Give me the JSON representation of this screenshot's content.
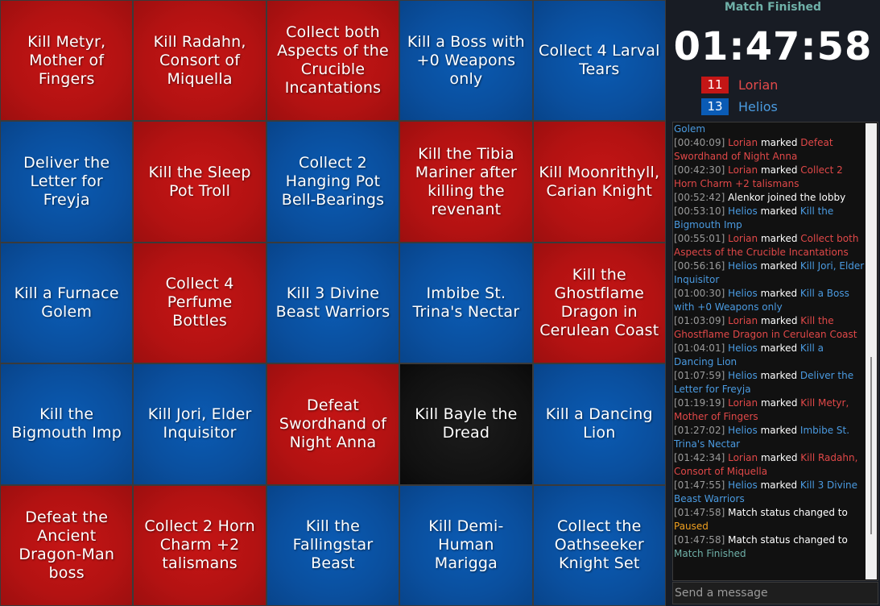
{
  "board": {
    "cells": [
      {
        "label": "Kill Metyr, Mother of Fingers",
        "color": "red"
      },
      {
        "label": "Kill Radahn, Consort of Miquella",
        "color": "red"
      },
      {
        "label": "Collect both Aspects of the Crucible Incantations",
        "color": "red"
      },
      {
        "label": "Kill a Boss with +0 Weapons only",
        "color": "blue"
      },
      {
        "label": "Collect 4 Larval Tears",
        "color": "blue"
      },
      {
        "label": "Deliver the Letter for Freyja",
        "color": "blue"
      },
      {
        "label": "Kill the Sleep Pot Troll",
        "color": "red"
      },
      {
        "label": "Collect 2 Hanging Pot Bell-Bearings",
        "color": "blue"
      },
      {
        "label": "Kill the Tibia Mariner after killing the revenant",
        "color": "red"
      },
      {
        "label": "Kill Moonrithyll, Carian Knight",
        "color": "red"
      },
      {
        "label": "Kill a Furnace Golem",
        "color": "blue"
      },
      {
        "label": "Collect 4 Perfume Bottles",
        "color": "red"
      },
      {
        "label": "Kill 3 Divine Beast Warriors",
        "color": "blue"
      },
      {
        "label": "Imbibe St. Trina's Nectar",
        "color": "blue"
      },
      {
        "label": "Kill the Ghostflame Dragon in Cerulean Coast",
        "color": "red"
      },
      {
        "label": "Kill the Bigmouth Imp",
        "color": "blue"
      },
      {
        "label": "Kill Jori, Elder Inquisitor",
        "color": "blue"
      },
      {
        "label": "Defeat Swordhand of Night Anna",
        "color": "red"
      },
      {
        "label": "Kill Bayle the Dread",
        "color": "black"
      },
      {
        "label": "Kill a Dancing Lion",
        "color": "blue"
      },
      {
        "label": "Defeat the Ancient Dragon-Man boss",
        "color": "red"
      },
      {
        "label": "Collect 2 Horn Charm +2 talismans",
        "color": "red"
      },
      {
        "label": "Kill the Fallingstar Beast",
        "color": "blue"
      },
      {
        "label": "Kill Demi-Human Marigga",
        "color": "blue"
      },
      {
        "label": "Collect the Oathseeker Knight Set",
        "color": "blue"
      }
    ]
  },
  "status": "Match Finished",
  "timer": "01:47:58",
  "teams": [
    {
      "count": "11",
      "name": "Lorian",
      "color": "#c41616"
    },
    {
      "count": "13",
      "name": "Helios",
      "color": "#0a5bb5"
    }
  ],
  "log": [
    {
      "segs": [
        {
          "t": "Golem",
          "c": "blue"
        }
      ]
    },
    {
      "ts": "[00:40:09]",
      "segs": [
        {
          "t": "Lorian",
          "c": "red"
        },
        {
          "t": " marked ",
          "c": "white"
        },
        {
          "t": "Defeat Swordhand of Night Anna",
          "c": "red"
        }
      ]
    },
    {
      "ts": "[00:42:30]",
      "segs": [
        {
          "t": "Lorian",
          "c": "red"
        },
        {
          "t": " marked ",
          "c": "white"
        },
        {
          "t": "Collect 2 Horn Charm +2 talismans",
          "c": "red"
        }
      ]
    },
    {
      "ts": "[00:52:42]",
      "segs": [
        {
          "t": "Alenkor joined the lobby",
          "c": "white"
        }
      ]
    },
    {
      "ts": "[00:53:10]",
      "segs": [
        {
          "t": "Helios",
          "c": "blue"
        },
        {
          "t": " marked ",
          "c": "white"
        },
        {
          "t": "Kill the Bigmouth Imp",
          "c": "blue"
        }
      ]
    },
    {
      "ts": "[00:55:01]",
      "segs": [
        {
          "t": "Lorian",
          "c": "red"
        },
        {
          "t": " marked ",
          "c": "white"
        },
        {
          "t": "Collect both Aspects of the Crucible Incantations",
          "c": "red"
        }
      ]
    },
    {
      "ts": "[00:56:16]",
      "segs": [
        {
          "t": "Helios",
          "c": "blue"
        },
        {
          "t": " marked ",
          "c": "white"
        },
        {
          "t": "Kill Jori, Elder Inquisitor",
          "c": "blue"
        }
      ]
    },
    {
      "ts": "[01:00:30]",
      "segs": [
        {
          "t": "Helios",
          "c": "blue"
        },
        {
          "t": " marked ",
          "c": "white"
        },
        {
          "t": "Kill a Boss with +0 Weapons only",
          "c": "blue"
        }
      ]
    },
    {
      "ts": "[01:03:09]",
      "segs": [
        {
          "t": "Lorian",
          "c": "red"
        },
        {
          "t": " marked ",
          "c": "white"
        },
        {
          "t": "Kill the Ghostflame Dragon in Cerulean Coast",
          "c": "red"
        }
      ]
    },
    {
      "ts": "[01:04:01]",
      "segs": [
        {
          "t": "Helios",
          "c": "blue"
        },
        {
          "t": " marked ",
          "c": "white"
        },
        {
          "t": "Kill a Dancing Lion",
          "c": "blue"
        }
      ]
    },
    {
      "ts": "[01:07:59]",
      "segs": [
        {
          "t": "Helios",
          "c": "blue"
        },
        {
          "t": " marked ",
          "c": "white"
        },
        {
          "t": "Deliver the Letter for Freyja",
          "c": "blue"
        }
      ]
    },
    {
      "ts": "[01:19:19]",
      "segs": [
        {
          "t": "Lorian",
          "c": "red"
        },
        {
          "t": " marked ",
          "c": "white"
        },
        {
          "t": "Kill Metyr, Mother of Fingers",
          "c": "red"
        }
      ]
    },
    {
      "ts": "[01:27:02]",
      "segs": [
        {
          "t": "Helios",
          "c": "blue"
        },
        {
          "t": " marked ",
          "c": "white"
        },
        {
          "t": "Imbibe St. Trina's Nectar",
          "c": "blue"
        }
      ]
    },
    {
      "ts": "[01:42:34]",
      "segs": [
        {
          "t": "Lorian",
          "c": "red"
        },
        {
          "t": " marked ",
          "c": "white"
        },
        {
          "t": "Kill Radahn, Consort of Miquella",
          "c": "red"
        }
      ]
    },
    {
      "ts": "[01:47:55]",
      "segs": [
        {
          "t": "Helios",
          "c": "blue"
        },
        {
          "t": " marked ",
          "c": "white"
        },
        {
          "t": "Kill 3 Divine Beast Warriors",
          "c": "blue"
        }
      ]
    },
    {
      "ts": "[01:47:58]",
      "segs": [
        {
          "t": "Match status changed to ",
          "c": "white"
        },
        {
          "t": "Paused",
          "c": "orange"
        }
      ]
    },
    {
      "ts": "[01:47:58]",
      "segs": [
        {
          "t": "Match status changed to ",
          "c": "white"
        },
        {
          "t": "Match Finished",
          "c": "teal"
        }
      ]
    }
  ],
  "message_input": {
    "placeholder": "Send a message"
  }
}
